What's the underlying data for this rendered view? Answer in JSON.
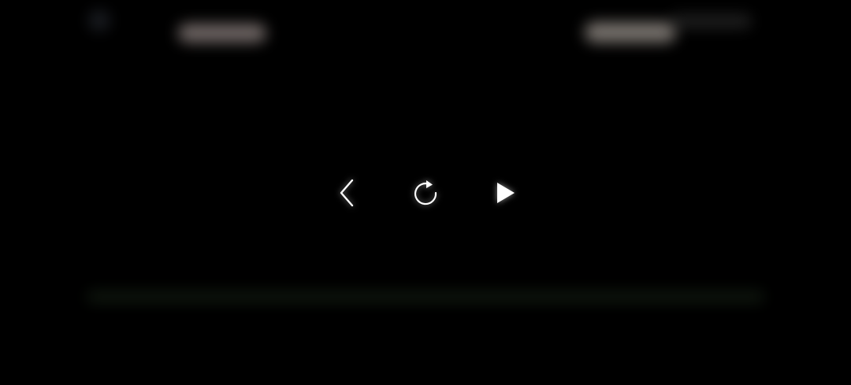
{
  "player": {
    "background_color": "#000000",
    "controls": [
      {
        "name": "previous",
        "icon": "chevron-left-icon"
      },
      {
        "name": "replay",
        "icon": "replay-icon"
      },
      {
        "name": "play",
        "icon": "play-icon"
      }
    ],
    "icon_color": "#ffffff"
  }
}
